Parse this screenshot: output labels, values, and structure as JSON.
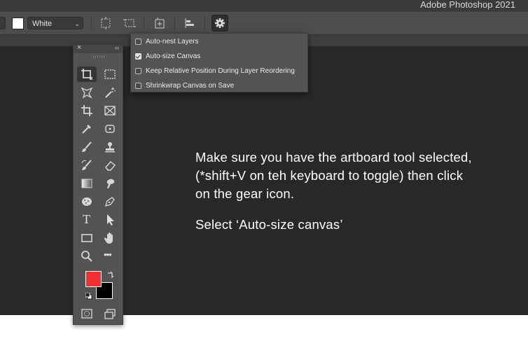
{
  "app": {
    "title": "Adobe Photoshop 2021"
  },
  "options_bar": {
    "color_select": {
      "value": "White"
    },
    "icons": [
      "artboard-from-layers-icon",
      "artboard-from-selection-icon",
      "add-artboard-icon",
      "align-icon",
      "gear-icon"
    ]
  },
  "artboard_settings_menu": {
    "items": [
      {
        "label": "Auto-nest Layers",
        "checked": false
      },
      {
        "label": "Auto-size Canvas",
        "checked": true
      },
      {
        "label": "Keep Relative Position During Layer Reordering",
        "checked": false
      },
      {
        "label": "Shrinkwrap Canvas on Save",
        "checked": false
      }
    ]
  },
  "toolbar": {
    "close_glyph": "×",
    "collapse_glyph": "‹‹",
    "tools": [
      [
        "artboard-tool-icon",
        "marquee-tool-icon"
      ],
      [
        "lasso-tool-icon",
        "magic-wand-tool-icon"
      ],
      [
        "crop-tool-icon",
        "frame-tool-icon"
      ],
      [
        "eyedropper-tool-icon",
        "patch-tool-icon"
      ],
      [
        "brush-tool-icon",
        "stamp-tool-icon"
      ],
      [
        "history-brush-tool-icon",
        "eraser-tool-icon"
      ],
      [
        "gradient-tool-icon",
        "smudge-tool-icon"
      ],
      [
        "sponge-tool-icon",
        "pen-tool-icon"
      ],
      [
        "type-tool-icon",
        "path-selection-tool-icon"
      ],
      [
        "rectangle-tool-icon",
        "hand-tool-icon"
      ],
      [
        "zoom-tool-icon",
        "more-tools-icon"
      ]
    ],
    "type_glyph": "T",
    "more_glyph": "•••",
    "foreground_color": "#f03030",
    "background_color": "#000000",
    "bottom_icons": [
      "quick-mask-icon",
      "screen-mode-icon"
    ]
  },
  "instructions": {
    "line1": "Make sure you have the artboard tool selected, (*shift+V on teh keyboard to toggle) then click on the gear icon.",
    "line2": "Select ‘Auto-size canvas’"
  }
}
